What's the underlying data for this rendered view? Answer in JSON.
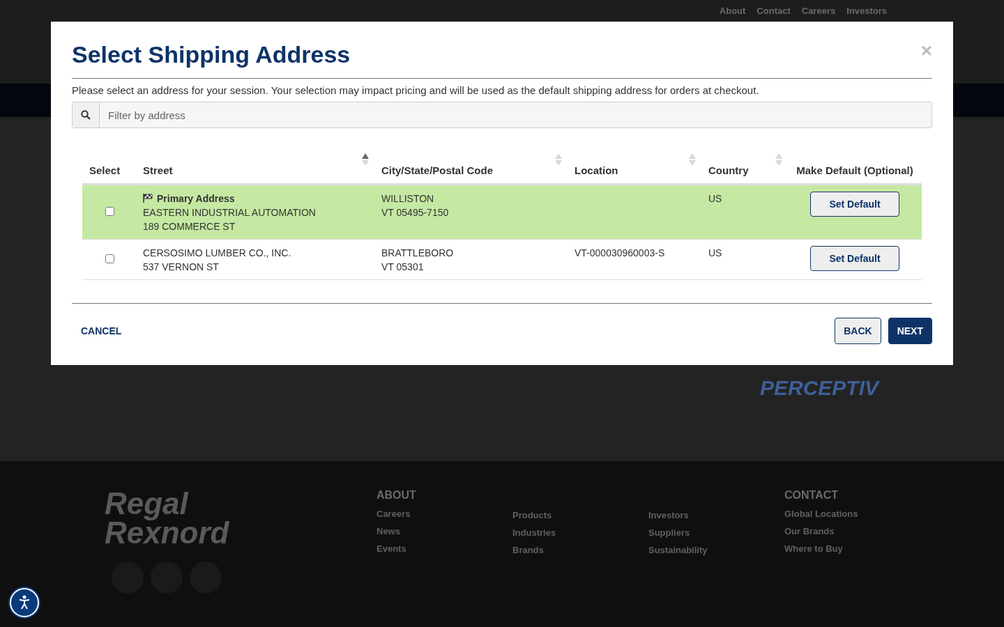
{
  "background": {
    "top_links": [
      "About",
      "Contact",
      "Careers",
      "Investors"
    ],
    "brand_word": "PERCEPTIV",
    "footer_logo": [
      "Regal",
      "Rexnord"
    ],
    "footer_columns": [
      {
        "heading": "ABOUT",
        "links": [
          "Careers",
          "News",
          "Events"
        ]
      },
      {
        "links": [
          "Products",
          "Industries",
          "Brands"
        ]
      },
      {
        "links": [
          "Investors",
          "Suppliers",
          "Sustainability"
        ]
      },
      {
        "heading": "CONTACT",
        "links": [
          "Global Locations",
          "Our Brands",
          "Where to Buy"
        ]
      }
    ]
  },
  "dialog": {
    "title": "Select Shipping Address",
    "close": "×",
    "description": "Please select an address for your session. Your selection may impact pricing and will be used as the default shipping address for orders at checkout.",
    "search": {
      "placeholder": "Filter by address"
    },
    "table": {
      "columns": [
        {
          "label": "Select",
          "sortable": false
        },
        {
          "label": "Street",
          "sortable": true,
          "sorted_ascending": true
        },
        {
          "label": "City/State/Postal Code",
          "sortable": true,
          "sorted_ascending": false
        },
        {
          "label": "Location",
          "sortable": true,
          "sorted_ascending": false
        },
        {
          "label": "Country",
          "sortable": true,
          "sorted_ascending": false
        },
        {
          "label": "Make Default (Optional)",
          "sortable": false
        }
      ],
      "rows": [
        {
          "primary": true,
          "primary_label": "Primary Address",
          "checked": false,
          "street": [
            "EASTERN INDUSTRIAL AUTOMATION",
            "189 COMMERCE ST"
          ],
          "city": [
            "WILLISTON",
            "VT 05495-7150"
          ],
          "country": "US",
          "button": "Set Default"
        },
        {
          "primary": false,
          "checked": false,
          "street": [
            "CERSOSIMO LUMBER CO., INC.",
            "537 VERNON ST"
          ],
          "city": [
            "BRATTLEBORO",
            "VT 05301"
          ],
          "location": "VT-000030960003-S",
          "country": "US",
          "button": "Set Default"
        }
      ]
    },
    "cancel": "CANCEL",
    "back": "BACK",
    "next": "NEXT"
  }
}
